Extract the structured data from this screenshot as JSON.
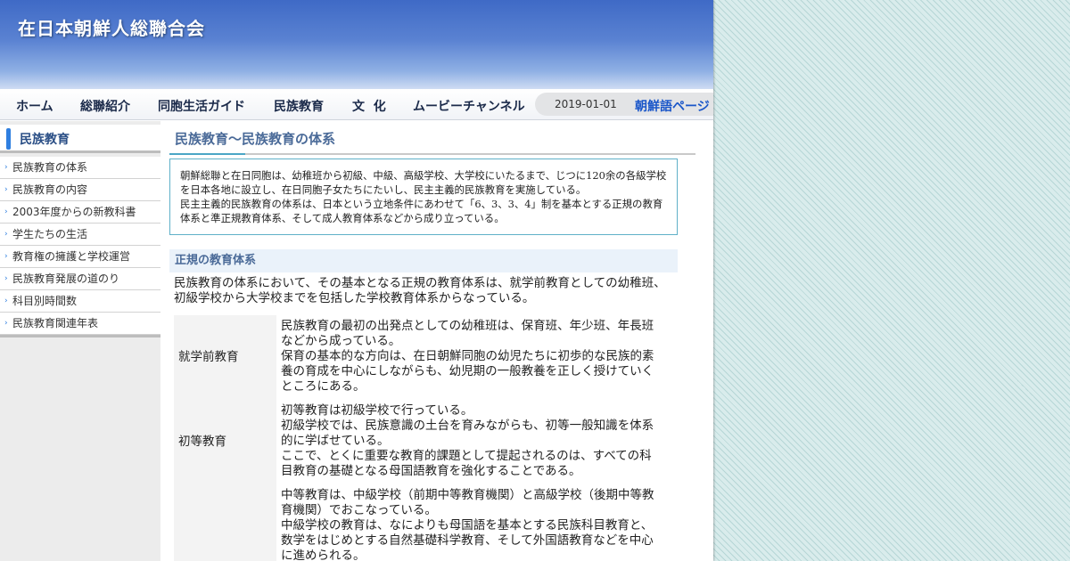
{
  "header": {
    "site_title": "在日本朝鮮人総聯合会"
  },
  "nav": {
    "items": [
      "ホーム",
      "総聯紹介",
      "同胞生活ガイド",
      "民族教育",
      "文  化",
      "ムービーチャンネル"
    ],
    "date": "2019-01-01",
    "korean_page": "朝鮮語ページ"
  },
  "sidebar": {
    "title": "民族教育",
    "items": [
      "民族教育の体系",
      "民族教育の内容",
      "2003年度からの新教科書",
      "学生たちの生活",
      "教育権の擁護と学校運営",
      "民族教育発展の道のり",
      "科目別時間数",
      "民族教育関連年表"
    ]
  },
  "main": {
    "page_title": "民族教育～民族教育の体系",
    "intro": [
      "朝鮮総聯と在日同胞は、幼稚班から初級、中級、高級学校、大学校にいたるまで、じつに120余の各級学校を日本各地に設立し、在日同胞子女たちにたいし、民主主義的民族教育を実施している。",
      "民主主義的民族教育の体系は、日本という立地条件にあわせて「6、3、3、4」制を基本とする正規の教育体系と準正規教育体系、そして成人教育体系などから成り立っている。"
    ],
    "section_heading": "正規の教育体系",
    "section_intro": "民族教育の体系において、その基本となる正規の教育体系は、就学前教育としての幼稚班、初級学校から大学校までを包括した学校教育体系からなっている。",
    "rows": [
      {
        "stage": "就学前教育",
        "lines": [
          "民族教育の最初の出発点としての幼稚班は、保育班、年少班、年長班などから成っている。",
          "保育の基本的な方向は、在日朝鮮同胞の幼児たちに初歩的な民族的素養の育成を中心にしながらも、幼児期の一般教養を正しく授けていくところにある。"
        ]
      },
      {
        "stage": "初等教育",
        "lines": [
          "初等教育は初級学校で行っている。",
          "初級学校では、民族意識の土台を育みながらも、初等一般知識を体系的に学ばせている。",
          "ここで、とくに重要な教育的課題として提起されるのは、すべての科目教育の基礎となる母国語教育を強化することである。"
        ]
      },
      {
        "stage": "",
        "lines": [
          "中等教育は、中級学校（前期中等教育機関）と高級学校（後期中等教育機関）でおこなっている。",
          "中級学校の教育は、なによりも母国語を基本とする民族科目教育と、数学をはじめとする自然基礎科学教育、そして外国語教育などを中心に進められる。"
        ]
      }
    ]
  },
  "colors": {
    "header_blue": "#3f6ac6",
    "accent": "#2f7fe0",
    "title_text": "#4a6a98",
    "korean_link": "#1a56c9",
    "box_border": "#5fb0c8"
  }
}
